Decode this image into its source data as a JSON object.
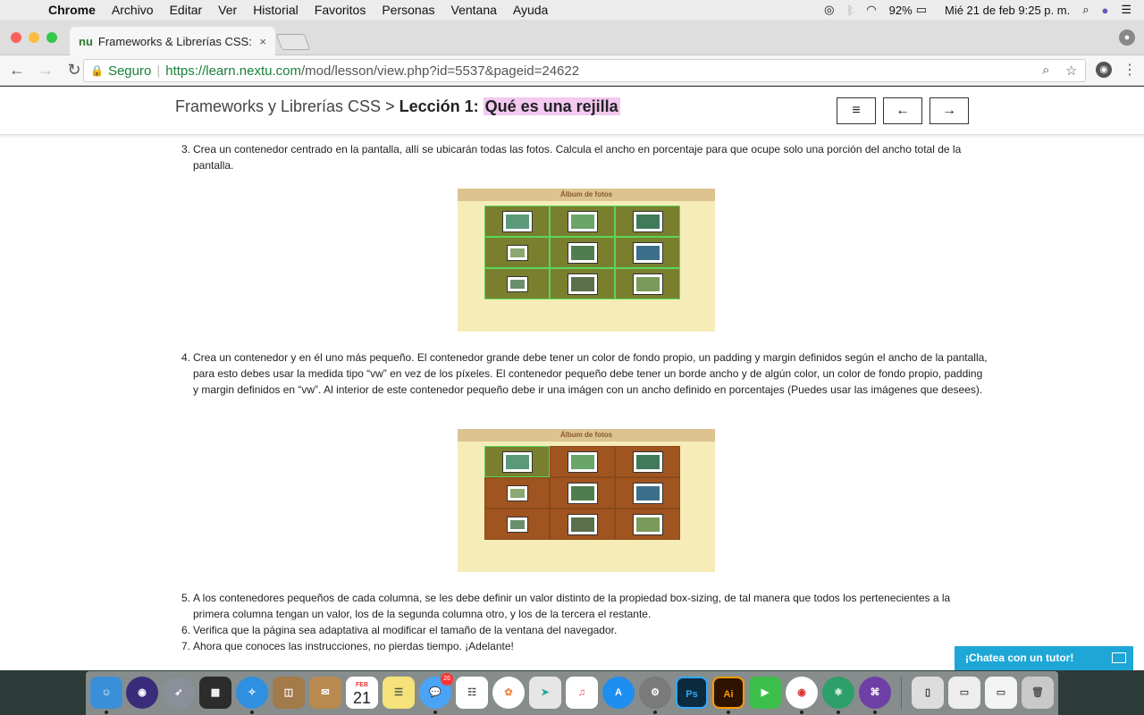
{
  "menubar": {
    "apple": "",
    "app": "Chrome",
    "items": [
      "Archivo",
      "Editar",
      "Ver",
      "Historial",
      "Favoritos",
      "Personas",
      "Ventana",
      "Ayuda"
    ],
    "battery": "92%",
    "datetime": "Mié 21 de feb  9:25 p. m."
  },
  "tab": {
    "favicon": "nu",
    "title": "Frameworks & Librerías CSS: L",
    "close": "×"
  },
  "toolbar": {
    "back": "←",
    "forward": "→",
    "reload": "↻",
    "secure_label": "Seguro",
    "url_host": "https://learn.nextu.com",
    "url_path": "/mod/lesson/view.php?id=5537&pageid=24622"
  },
  "header": {
    "course": "Frameworks y Librerías CSS",
    "sep": " > ",
    "lesson": "Lección 1:",
    "lesson_title": "Qué es una rejilla",
    "btn_menu": "≡",
    "btn_prev": "←",
    "btn_next": "→"
  },
  "items": [
    {
      "num": "3.",
      "text": "Crea un contenedor centrado en la pantalla, allí se ubicarán todas las fotos. Calcula el ancho en porcentaje para que ocupe solo una porción del ancho total de la pantalla."
    },
    {
      "num": "4.",
      "text": "Crea un contenedor y en él uno más pequeño. El contenedor grande debe tener un color de fondo propio, un padding y margin definidos según el ancho de la pantalla, para esto debes usar la medida tipo “vw” en vez de los píxeles. El contenedor pequeño debe tener un borde ancho y de algún color, un color de fondo propio, padding y margin definidos en “vw”. Al interior de este contenedor pequeño debe ir una imágen con un ancho definido en porcentajes (Puedes usar las imágenes que desees)."
    },
    {
      "num": "5.",
      "text": "A los contenedores pequeños de cada columna, se les debe definir un valor distinto de la propiedad box-sizing, de tal manera que todos los pertenecientes a la primera columna tengan un valor, los de la segunda columna otro, y los de la tercera el restante."
    },
    {
      "num": "6.",
      "text": "Verifica que la página sea adaptativa al modificar el tamaño de la ventana del navegador."
    },
    {
      "num": "7.",
      "text": "Ahora que conoces las instrucciones, no pierdas tiempo. ¡Adelante!"
    }
  ],
  "album": {
    "title": "Álbum de fotos",
    "figure1_cell_color": "#7a7f2e",
    "figure2_cell_color": "#a0541f",
    "highlight_color": "#59d65a"
  },
  "chat": {
    "label": "¡Chatea con un tutor!"
  },
  "dock": {
    "calendar_month": "FEB",
    "calendar_day": "21",
    "messages_badge": "26",
    "ps_label": "Ps",
    "ai_label": "Ai"
  }
}
